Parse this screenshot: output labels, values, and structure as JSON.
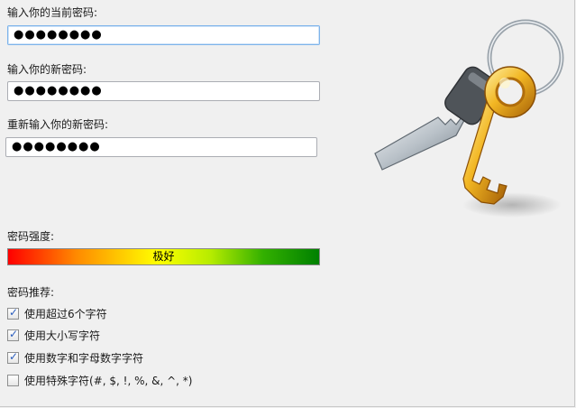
{
  "form": {
    "current_label": "输入你的当前密码:",
    "current_value": "●●●●●●●●",
    "new_label": "输入你的新密码:",
    "new_value": "●●●●●●●●",
    "confirm_label": "重新输入你的新密码:",
    "confirm_value": "●●●●●●●●"
  },
  "strength": {
    "label": "密码强度:",
    "value_text": "极好",
    "colors": [
      "#ff0000",
      "#ff8a00",
      "#ffff00",
      "#b7ec00",
      "#33b000",
      "#008000"
    ]
  },
  "recommendations": {
    "title": "密码推荐:",
    "items": [
      {
        "label": "使用超过6个字符",
        "checked": true
      },
      {
        "label": "使用大小写字符",
        "checked": true
      },
      {
        "label": "使用数字和字母数字字符",
        "checked": true
      },
      {
        "label": "使用特殊字符(#, $, !, %, &, ^, *)",
        "checked": false
      }
    ]
  },
  "illustration": {
    "icon": "keys-icon"
  }
}
